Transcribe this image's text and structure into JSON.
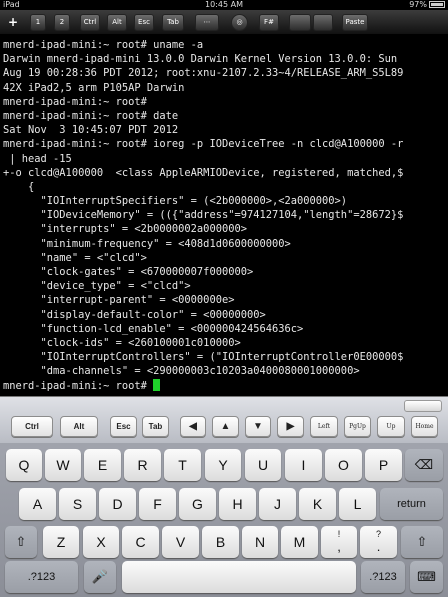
{
  "status": {
    "carrier": "iPad",
    "time": "10:45 AM",
    "battery": "97%"
  },
  "toolbar": {
    "plus": "+",
    "k1": "1",
    "k2": "2",
    "ctrl": "Ctrl",
    "alt": "Alt",
    "esc": "Esc",
    "tab": "Tab",
    "dots": "⋯",
    "circle": "◎",
    "fn": "F#",
    "blank": "",
    "paste": "Paste"
  },
  "terminal": {
    "lines": [
      "mnerd-ipad-mini:~ root# uname -a",
      "Darwin mnerd-ipad-mini 13.0.0 Darwin Kernel Version 13.0.0: Sun",
      "Aug 19 00:28:36 PDT 2012; root:xnu-2107.2.33~4/RELEASE_ARM_S5L89",
      "42X iPad2,5 arm P105AP Darwin",
      "mnerd-ipad-mini:~ root#",
      "mnerd-ipad-mini:~ root# date",
      "Sat Nov  3 10:45:07 PDT 2012",
      "mnerd-ipad-mini:~ root# ioreg -p IODeviceTree -n clcd@A100000 -r",
      " | head -15",
      "+-o clcd@A100000  <class AppleARMIODevice, registered, matched,$",
      "    {",
      "      \"IOInterruptSpecifiers\" = (<2b000000>,<2a000000>)",
      "      \"IODeviceMemory\" = (({\"address\"=974127104,\"length\"=28672}$",
      "      \"interrupts\" = <2b0000002a000000>",
      "      \"minimum-frequency\" = <408d1d0600000000>",
      "      \"name\" = <\"clcd\">",
      "      \"clock-gates\" = <670000007f000000>",
      "      \"device_type\" = <\"clcd\">",
      "      \"interrupt-parent\" = <0000000e>",
      "      \"display-default-color\" = <00000000>",
      "      \"function-lcd_enable\" = <000000424564636c>",
      "      \"clock-ids\" = <260100001c010000>",
      "      \"IOInterruptControllers\" = (\"IOInterruptController0E00000$",
      "      \"dma-channels\" = <290000003c10203a0400080001000000>",
      "mnerd-ipad-mini:~ root# "
    ]
  },
  "extra_keys": {
    "ctrl": "Ctrl",
    "alt": "Alt",
    "esc": "Esc",
    "tab": "Tab",
    "left": "◀",
    "up": "▲",
    "down": "▼",
    "right": "▶",
    "home_left": "Left",
    "pgup": "PgUp",
    "up_text": "Up",
    "home": "Home"
  },
  "keyboard": {
    "row1": [
      "Q",
      "W",
      "E",
      "R",
      "T",
      "Y",
      "U",
      "I",
      "O",
      "P"
    ],
    "row2": [
      "A",
      "S",
      "D",
      "F",
      "G",
      "H",
      "J",
      "K",
      "L"
    ],
    "row3": [
      "Z",
      "X",
      "C",
      "V",
      "B",
      "N",
      "M"
    ],
    "return": "return",
    "backspace": "⌫",
    "shift": "⇧",
    "excl_top": "!",
    "excl_bot": ",",
    "q_top": "?",
    "q_bot": ".",
    "numbers": ".?123",
    "mic": "🎤",
    "hide": "⌨"
  }
}
